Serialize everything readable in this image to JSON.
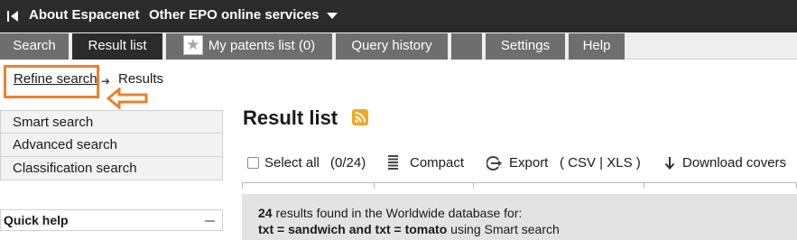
{
  "topbar": {
    "about": "About Espacenet",
    "other": "Other EPO online services"
  },
  "tabs": [
    {
      "label": "Search"
    },
    {
      "label": "Result list"
    },
    {
      "label": "My patents list (0)"
    },
    {
      "label": "Query history"
    },
    {
      "label": ""
    },
    {
      "label": "Settings"
    },
    {
      "label": "Help"
    }
  ],
  "breadcrumb": {
    "refine": "Refine search",
    "results": "Results"
  },
  "leftmenu": {
    "items": [
      "Smart search",
      "Advanced search",
      "Classification search"
    ],
    "quick_help": "Quick help"
  },
  "main": {
    "title": "Result list",
    "toolbar": {
      "select_all": "Select all",
      "count": "(0/24)",
      "compact": "Compact",
      "export_label": "Export",
      "export_formats": "( CSV | XLS )",
      "download_covers": "Download covers"
    },
    "results": {
      "count": "24",
      "found_text": "results found in the Worldwide database for:",
      "query": "txt = sandwich and txt = tomato",
      "using_text": "using Smart search"
    }
  },
  "colors": {
    "topbar_bg": "#2b2b2b",
    "tab_bg": "#6e6e6e",
    "highlight_orange": "#f07f2a"
  }
}
